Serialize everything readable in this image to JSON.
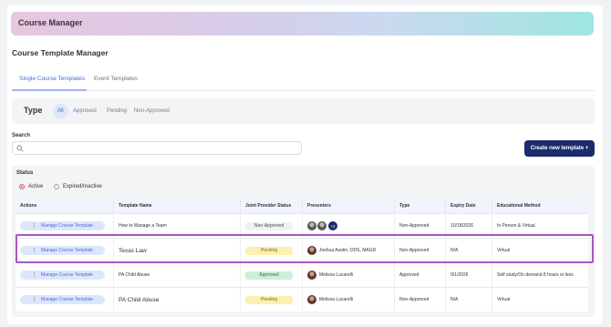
{
  "header": {
    "title": "Course Manager"
  },
  "page": {
    "title": "Course Template Manager"
  },
  "tabs": [
    {
      "label": "Single Course Templates"
    },
    {
      "label": "Event Templates"
    }
  ],
  "type_filter": {
    "label": "Type",
    "options": [
      {
        "label": "All"
      },
      {
        "label": "Approved"
      },
      {
        "label": "Pending"
      },
      {
        "label": "Non-Approved"
      }
    ]
  },
  "search": {
    "label": "Search",
    "placeholder": "",
    "value": ""
  },
  "create_button": {
    "label": "Create new template  +"
  },
  "status": {
    "label": "Status",
    "options": [
      {
        "label": "Active",
        "selected": true
      },
      {
        "label": "Expired/Inactive",
        "selected": false
      }
    ]
  },
  "table": {
    "columns": [
      "Actions",
      "Template Name",
      "Joint Provider Status",
      "Presenters",
      "Type",
      "Expiry Date",
      "Educational Method"
    ],
    "action_label": "Manage Course Template",
    "rows": [
      {
        "template_name": "How to Manage a Team",
        "jp_status": "Non-Approved",
        "presenter": "",
        "extra_presenters": "+2",
        "type": "Non-Approved",
        "expiry": "10/18/2026",
        "method": "In Person & Virtual"
      },
      {
        "template_name": "Texas Law",
        "jp_status": "Pending",
        "presenter": "Joshua Austin, DDS, MAGD",
        "type": "Non-Approved",
        "expiry": "N/A",
        "method": "Virtual"
      },
      {
        "template_name": "PA Child Abuse",
        "jp_status": "Approved",
        "presenter": "Melissa Lucarelli",
        "type": "Approved",
        "expiry": "9/1/2026",
        "method": "Self study/On demand 8 hours or less"
      },
      {
        "template_name": "PA Child Abuse",
        "jp_status": "Pending",
        "presenter": "Melissa Lucarelli",
        "type": "Non-Approved",
        "expiry": "N/A",
        "method": "Virtual"
      }
    ]
  },
  "colors": {
    "accent": "#4a6bd8",
    "primary_button": "#1c2b6a",
    "highlight": "#a656c5"
  }
}
